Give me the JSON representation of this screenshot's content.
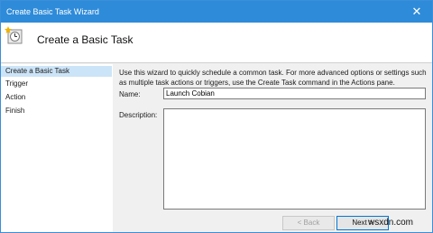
{
  "window": {
    "title": "Create Basic Task Wizard",
    "close_glyph": "✕"
  },
  "header": {
    "title": "Create a Basic Task",
    "icon": "task-scheduler-icon"
  },
  "sidebar": {
    "items": [
      {
        "label": "Create a Basic Task",
        "active": true
      },
      {
        "label": "Trigger",
        "active": false
      },
      {
        "label": "Action",
        "active": false
      },
      {
        "label": "Finish",
        "active": false
      }
    ]
  },
  "main": {
    "intro_text": "Use this wizard to quickly schedule a common task.  For more advanced options or settings such as multiple task actions or triggers, use the Create Task command in the Actions pane.",
    "name_label": "Name:",
    "name_value": "Launch Cobian",
    "description_label": "Description:",
    "description_value": ""
  },
  "buttons": {
    "back": "< Back",
    "next": "Next >"
  },
  "watermark": "wsxdn.com",
  "colors": {
    "titlebar": "#2e8bd9",
    "active_item": "#cce4f7",
    "focus_border": "#0078d7"
  }
}
